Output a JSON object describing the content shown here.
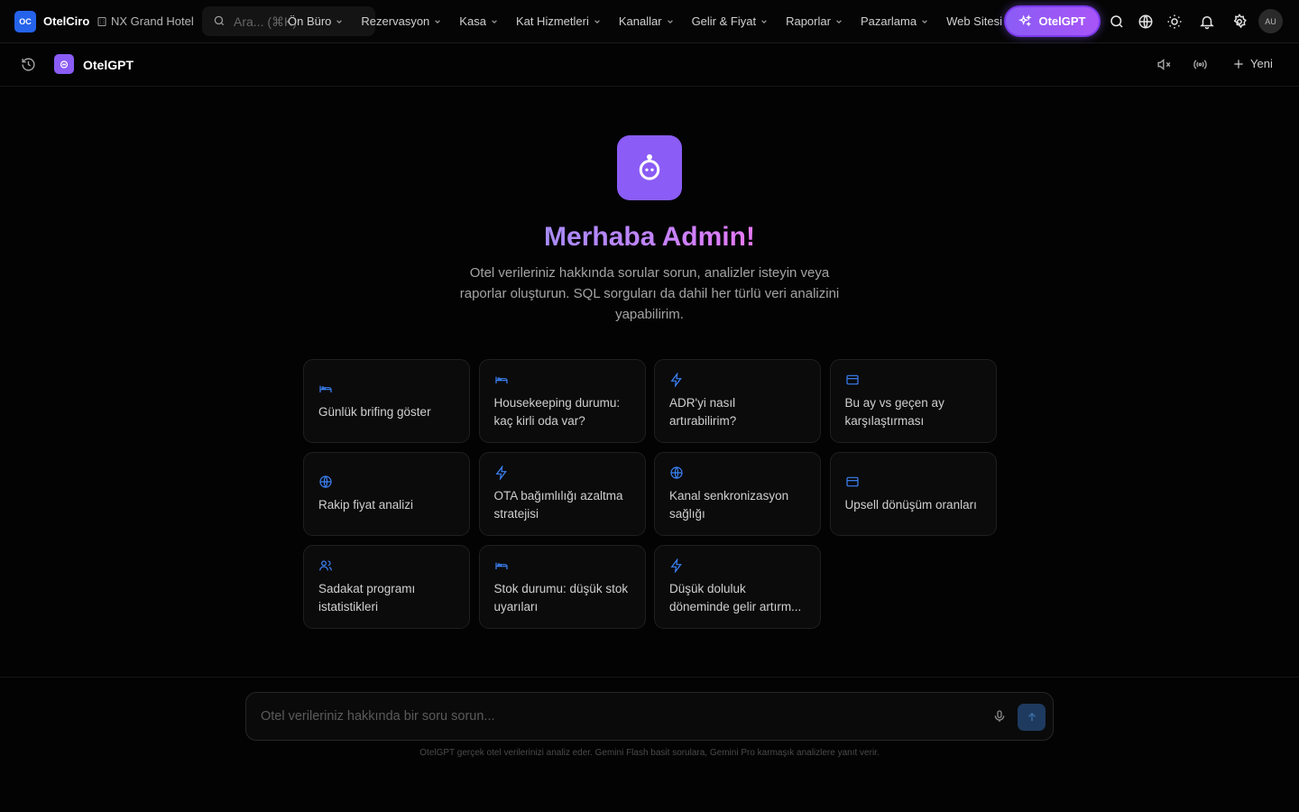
{
  "topbar": {
    "logo_badge": "OC",
    "brand": "OtelCiro",
    "hotel": "NX Grand Hotel",
    "search_placeholder": "Ara... (⌘K)",
    "nav": [
      "Ön Büro",
      "Rezervasyon",
      "Kasa",
      "Kat Hizmetleri",
      "Kanallar",
      "Gelir & Fiyat",
      "Raporlar",
      "Pazarlama",
      "Web Sitesi"
    ],
    "gpt_button": "OtelGPT",
    "icons": [
      "search-icon",
      "globe-icon",
      "sun-icon",
      "bell-icon",
      "gear-icon"
    ],
    "avatar": "AU"
  },
  "subbar": {
    "title": "OtelGPT",
    "new_label": "Yeni"
  },
  "hero": {
    "greeting": "Merhaba Admin!",
    "intro": "Otel verileriniz hakkında sorular sorun, analizler isteyin veya raporlar oluşturun. SQL sorguları da dahil her türlü veri analizini yapabilirim."
  },
  "suggestions": [
    {
      "icon": "bed-icon",
      "text": "Günlük brifing göster"
    },
    {
      "icon": "bed-icon",
      "text": "Housekeeping durumu: kaç kirli oda var?"
    },
    {
      "icon": "bolt-icon",
      "text": "ADR'yi nasıl artırabilirim?"
    },
    {
      "icon": "card-icon",
      "text": "Bu ay vs geçen ay karşılaştırması"
    },
    {
      "icon": "globe-icon",
      "text": "Rakip fiyat analizi"
    },
    {
      "icon": "bolt-icon",
      "text": "OTA bağımlılığı azaltma stratejisi"
    },
    {
      "icon": "globe-icon",
      "text": "Kanal senkronizasyon sağlığı"
    },
    {
      "icon": "card-icon",
      "text": "Upsell dönüşüm oranları"
    },
    {
      "icon": "users-icon",
      "text": "Sadakat programı istatistikleri"
    },
    {
      "icon": "bed-icon",
      "text": "Stok durumu: düşük stok uyarıları"
    },
    {
      "icon": "bolt-icon",
      "text": "Düşük doluluk döneminde gelir artırm..."
    }
  ],
  "composer": {
    "placeholder": "Otel verileriniz hakkında bir soru sorun...",
    "footnote": "OtelGPT gerçek otel verilerinizi analiz eder. Gemini Flash basit sorulara, Gemini Pro karmaşık analizlere yanıt verir."
  },
  "colors": {
    "accent": "#8b5cf6",
    "brand_blue": "#2563eb",
    "icon_blue": "#3b82f6",
    "background": "#030303"
  }
}
